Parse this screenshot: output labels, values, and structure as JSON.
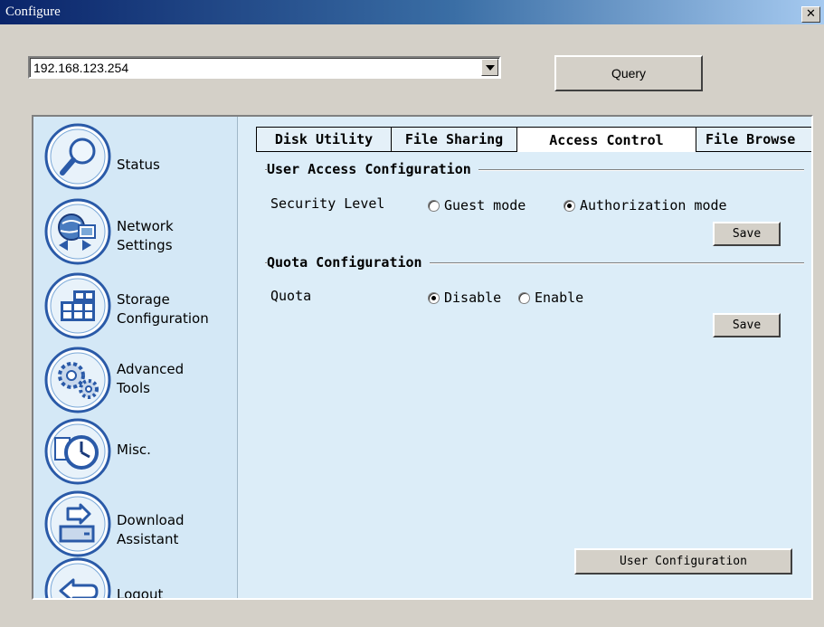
{
  "window": {
    "title": "Configure",
    "close_glyph": "✕"
  },
  "address": {
    "value": "192.168.123.254"
  },
  "query_label": "Query",
  "sidebar": {
    "items": [
      {
        "label": "Status",
        "icon": "magnifier-icon"
      },
      {
        "label": "Network\nSettings",
        "icon": "network-globe-icon"
      },
      {
        "label": "Storage\nConfiguration",
        "icon": "storage-grid-icon"
      },
      {
        "label": "Advanced\nTools",
        "icon": "gears-icon"
      },
      {
        "label": "Misc.",
        "icon": "clock-icon"
      },
      {
        "label": "Download\nAssistant",
        "icon": "download-tray-icon"
      },
      {
        "label": "Logout",
        "icon": "back-arrow-icon"
      }
    ]
  },
  "tabs": [
    {
      "label": "Disk Utility",
      "active": false
    },
    {
      "label": "File Sharing",
      "active": false
    },
    {
      "label": "Access Control",
      "active": true
    },
    {
      "label": "File Browse",
      "active": false
    }
  ],
  "user_access": {
    "title": "User Access Configuration",
    "field_label": "Security Level",
    "options": [
      {
        "label": "Guest mode",
        "selected": false
      },
      {
        "label": "Authorization mode",
        "selected": true
      }
    ],
    "save_label": "Save"
  },
  "quota": {
    "title": "Quota Configuration",
    "field_label": "Quota",
    "options": [
      {
        "label": "Disable",
        "selected": true
      },
      {
        "label": "Enable",
        "selected": false
      }
    ],
    "save_label": "Save"
  },
  "user_config_label": "User Configuration",
  "colors": {
    "sidebar_bg": "#d4e8f6",
    "content_bg": "#dcedf8",
    "icon_ring": "#2a5aa8",
    "titlebar": "#0a246a"
  }
}
